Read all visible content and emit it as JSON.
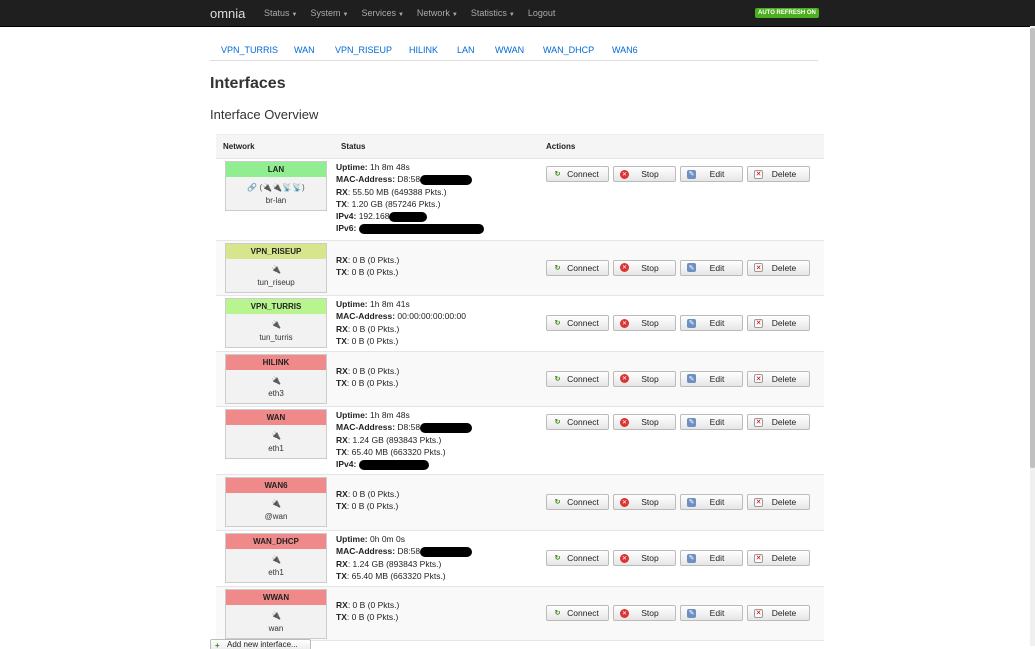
{
  "nav": {
    "brand": "omnia",
    "menu": [
      "Status",
      "System",
      "Services",
      "Network",
      "Statistics"
    ],
    "logout": "Logout",
    "auto_refresh": "AUTO REFRESH ON"
  },
  "tabs": [
    "VPN_TURRIS",
    "WAN",
    "VPN_RISEUP",
    "HILINK",
    "LAN",
    "WWAN",
    "WAN_DHCP",
    "WAN6"
  ],
  "page_title": "Interfaces",
  "section_title": "Interface Overview",
  "table": {
    "col_network": "Network",
    "col_status": "Status",
    "col_actions": "Actions"
  },
  "buttons": {
    "connect": "Connect",
    "stop": "Stop",
    "edit": "Edit",
    "delete": "Delete"
  },
  "colors": {
    "green": "#90ee90",
    "yellowgreen": "#d7e58c",
    "lightgreen": "#b9f58f",
    "red": "#f08a8a"
  },
  "interfaces": [
    {
      "name": "LAN",
      "device": "br-lan",
      "icons": "🔗 (🔌🔌📡📡)",
      "uptime": "1h 8m 48s",
      "mac": "D8:58",
      "rx": "55.50 MB (649388 Pkts.)",
      "tx": "1.20 GB (857246 Pkts.)",
      "ipv4": "192.168",
      "ipv6": ""
    },
    {
      "name": "VPN_RISEUP",
      "device": "tun_riseup",
      "icons": "🔌",
      "rx": "0 B (0 Pkts.)",
      "tx": "0 B (0 Pkts.)"
    },
    {
      "name": "VPN_TURRIS",
      "device": "tun_turris",
      "icons": "🔌",
      "uptime": "1h 8m 41s",
      "mac": "00:00:00:00:00:00",
      "rx": "0 B (0 Pkts.)",
      "tx": "0 B (0 Pkts.)"
    },
    {
      "name": "HILINK",
      "device": "eth3",
      "icons": "🔌",
      "rx": "0 B (0 Pkts.)",
      "tx": "0 B (0 Pkts.)"
    },
    {
      "name": "WAN",
      "device": "eth1",
      "icons": "🔌",
      "uptime": "1h 8m 48s",
      "mac": "D8:58",
      "rx": "1.24 GB (893843 Pkts.)",
      "tx": "65.40 MB (663320 Pkts.)",
      "ipv4": ""
    },
    {
      "name": "WAN6",
      "device": "@wan",
      "icons": "🔌",
      "rx": "0 B (0 Pkts.)",
      "tx": "0 B (0 Pkts.)"
    },
    {
      "name": "WAN_DHCP",
      "device": "eth1",
      "icons": "🔌",
      "uptime": "0h 0m 0s",
      "mac": "D8:58",
      "rx": "1.24 GB (893843 Pkts.)",
      "tx": "65.40 MB (663320 Pkts.)"
    },
    {
      "name": "WWAN",
      "device": "wan",
      "icons": "🔌",
      "rx": "0 B (0 Pkts.)",
      "tx": "0 B (0 Pkts.)"
    }
  ],
  "labels": {
    "uptime": "Uptime:",
    "mac": "MAC-Address:",
    "rx": "RX",
    "tx": "TX",
    "ipv4": "IPv4:",
    "ipv6": "IPv6:"
  },
  "add_button": "Add new interface..."
}
